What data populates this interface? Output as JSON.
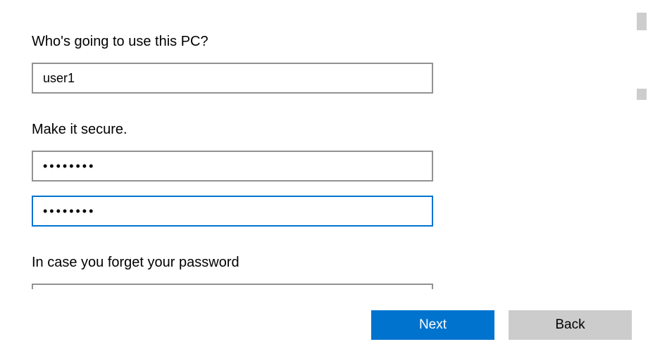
{
  "sections": {
    "username": {
      "label": "Who's going to use this PC?",
      "value": "user1"
    },
    "password": {
      "label": "Make it secure.",
      "value": "••••••••",
      "confirm_value": "••••••••"
    },
    "hint": {
      "label": "In case you forget your password"
    }
  },
  "buttons": {
    "next": "Next",
    "back": "Back"
  }
}
